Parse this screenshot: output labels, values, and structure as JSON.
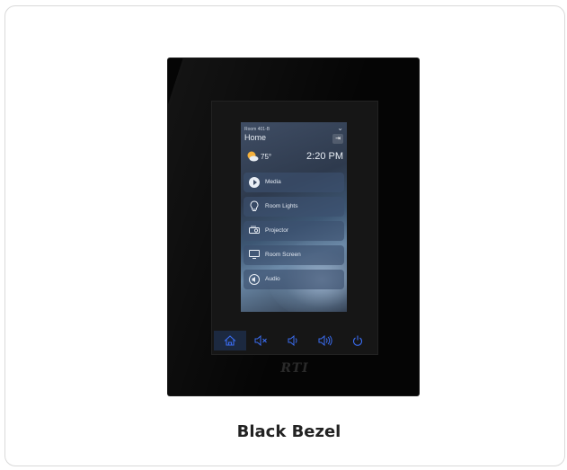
{
  "caption": "Black Bezel",
  "screen": {
    "room": "Room 401-B",
    "title": "Home",
    "temperature": "75°",
    "time": "2:20 PM",
    "weather_icon": "partly-cloudy-icon",
    "buttons": [
      {
        "label": "Media",
        "icon": "play-icon"
      },
      {
        "label": "Room Lights",
        "icon": "lightbulb-icon"
      },
      {
        "label": "Projector",
        "icon": "projector-icon"
      },
      {
        "label": "Room Screen",
        "icon": "monitor-icon"
      },
      {
        "label": "Audio",
        "icon": "audio-icon"
      }
    ]
  },
  "hard_keys": [
    "home-icon",
    "mute-icon",
    "volume-down-icon",
    "volume-up-icon",
    "power-icon"
  ],
  "logo": "RTI",
  "colors": {
    "bezel": "#050505",
    "key_accent": "#3a6cf0",
    "card_border": "#d9d9d9"
  }
}
